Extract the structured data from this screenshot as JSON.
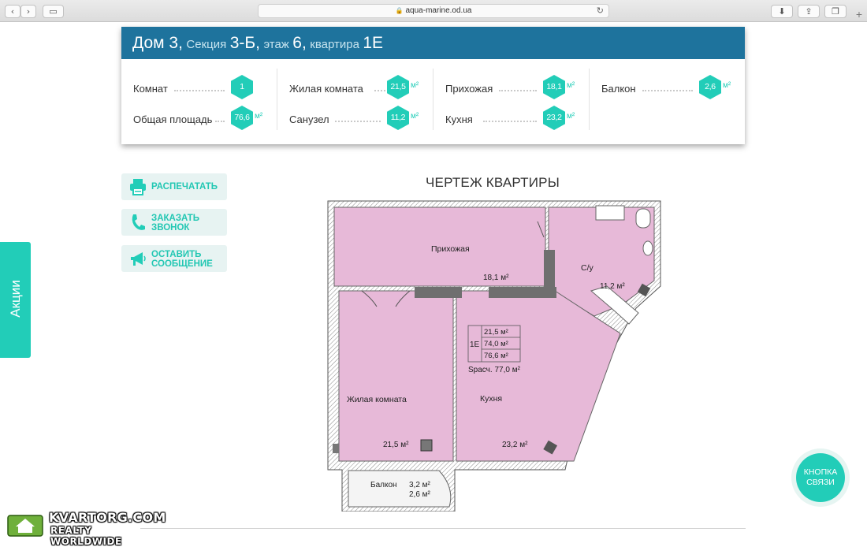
{
  "browser": {
    "url": "aqua-marine.od.ua",
    "back_icon": "chevron-left-icon",
    "forward_icon": "chevron-right-icon",
    "sidebar_icon": "sidebar-icon",
    "reload_icon": "reload-icon",
    "download_icon": "download-icon",
    "share_icon": "share-icon",
    "tabs_icon": "tabs-icon",
    "new_tab_icon": "plus-icon"
  },
  "header": {
    "house": "Дом 3,",
    "section_label": "Секция",
    "section_value": "3-Б,",
    "floor_label": "этаж",
    "floor_value": "6,",
    "apt_label": "квартира",
    "apt_value": "1Е"
  },
  "stats": {
    "unit": "м²",
    "rooms": {
      "label": "Комнат",
      "value": "1"
    },
    "total_area": {
      "label": "Общая площадь",
      "value": "76,6"
    },
    "living_room": {
      "label": "Жилая комната",
      "value": "21,5"
    },
    "bathroom": {
      "label": "Санузел",
      "value": "11,2"
    },
    "hallway": {
      "label": "Прихожая",
      "value": "18,1"
    },
    "kitchen": {
      "label": "Кухня",
      "value": "23,2"
    },
    "balcony": {
      "label": "Балкон",
      "value": "2,6"
    }
  },
  "actions": {
    "print": {
      "label": "Распечатать",
      "icon": "printer-icon"
    },
    "call_line1": "Заказать",
    "call_line2": "звонок",
    "call_icon": "phone-icon",
    "message_line1": "Оставить",
    "message_line2": "сообщение",
    "message_icon": "megaphone-icon"
  },
  "side_tab": "Акции",
  "plan": {
    "title": "ЧЕРТЕЖ КВАРТИРЫ",
    "hallway": {
      "name": "Прихожая",
      "area": "18,1 м²"
    },
    "bathroom": {
      "name": "С/у",
      "area": "11,2 м²"
    },
    "living": {
      "name": "Жилая комната",
      "area": "21,5 м²"
    },
    "kitchen": {
      "name": "Кухня",
      "area": "23,2 м²"
    },
    "balcony": {
      "name": "Балкон",
      "area1": "3,2 м²",
      "area2": "2,6 м²"
    },
    "summary": {
      "apt": "1Е",
      "living": "21,5 м²",
      "total": "74,0 м²",
      "total_bal": "76,6 м²",
      "calc": "Sрасч. 77,0 м²"
    }
  },
  "contact_button": {
    "line1": "КНОПКА",
    "line2": "СВЯЗИ"
  },
  "watermark": {
    "line1": "KVARTORG.COM",
    "line2": "REALTY WORLDWIDE"
  },
  "colors": {
    "header_blue": "#1e739d",
    "accent": "#22cdb8",
    "room_fill": "#e7b9d8"
  }
}
